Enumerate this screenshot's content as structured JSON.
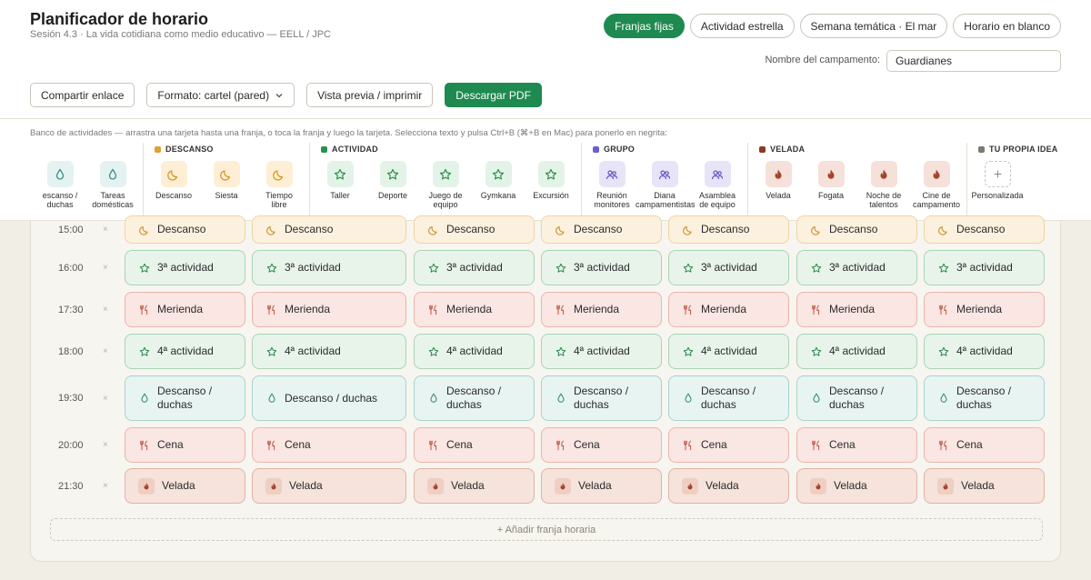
{
  "header": {
    "title": "Planificador de horario",
    "subtitle": "Sesión 4.3 · La vida cotidiana como medio educativo — EELL / JPC"
  },
  "modes": [
    {
      "label": "Franjas fijas",
      "active": true
    },
    {
      "label": "Actividad estrella",
      "active": false
    },
    {
      "label": "Semana temática · El mar",
      "active": false
    },
    {
      "label": "Horario en blanco",
      "active": false
    }
  ],
  "camp": {
    "label": "Nombre del campamento:",
    "value": "Guardianes"
  },
  "toolbar": {
    "share": "Compartir enlace",
    "format": "Formato: cartel (pared)",
    "preview": "Vista previa / imprimir",
    "download": "Descargar PDF"
  },
  "bank": {
    "hint": "Banco de actividades — arrastra una tarjeta hasta una franja, o toca la franja y luego la tarjeta. Selecciona texto y pulsa Ctrl+B (⌘+B en Mac) para ponerlo en negrita:",
    "groups": [
      {
        "title": "",
        "color": "#3c8b86",
        "cards": [
          {
            "label": "escanso /\nduchas",
            "icon": "drop-icon",
            "kind": "shower"
          },
          {
            "label": "Tareas\ndomésticas",
            "icon": "drop-icon",
            "kind": "shower"
          }
        ]
      },
      {
        "title": "DESCANSO",
        "color": "#e0a22a",
        "cards": [
          {
            "label": "Descanso",
            "icon": "moon-icon",
            "kind": "rest"
          },
          {
            "label": "Siesta",
            "icon": "moon-icon",
            "kind": "rest"
          },
          {
            "label": "Tiempo\nlibre",
            "icon": "moon-icon",
            "kind": "rest"
          }
        ]
      },
      {
        "title": "ACTIVIDAD",
        "color": "#2a9150",
        "cards": [
          {
            "label": "Taller",
            "icon": "star-icon",
            "kind": "act"
          },
          {
            "label": "Deporte",
            "icon": "star-icon",
            "kind": "act"
          },
          {
            "label": "Juego de\nequipo",
            "icon": "star-icon",
            "kind": "act"
          },
          {
            "label": "Gymkana",
            "icon": "star-icon",
            "kind": "act"
          },
          {
            "label": "Excursión",
            "icon": "star-icon",
            "kind": "act"
          }
        ]
      },
      {
        "title": "GRUPO",
        "color": "#6a5fd0",
        "cards": [
          {
            "label": "Reunión\nmonitores",
            "icon": "people-icon",
            "kind": "grp"
          },
          {
            "label": "Diana\ncampamentistas",
            "icon": "people-icon",
            "kind": "grp"
          },
          {
            "label": "Asamblea\nde equipo",
            "icon": "people-icon",
            "kind": "grp"
          }
        ]
      },
      {
        "title": "VELADA",
        "color": "#8c3a24",
        "cards": [
          {
            "label": "Velada",
            "icon": "flame-icon",
            "kind": "vel"
          },
          {
            "label": "Fogata",
            "icon": "flame-icon",
            "kind": "vel"
          },
          {
            "label": "Noche de\ntalentos",
            "icon": "flame-icon",
            "kind": "vel"
          },
          {
            "label": "Cine de\ncampamento",
            "icon": "flame-icon",
            "kind": "vel"
          }
        ]
      },
      {
        "title": "TU PROPIA IDEA",
        "color": "#7a7a6e",
        "cards": [
          {
            "label": "Personalizada",
            "icon": "plus-icon",
            "kind": "own"
          }
        ]
      }
    ]
  },
  "schedule": {
    "remove_symbol": "×",
    "rows": [
      {
        "time": "15:00",
        "kind": "rest",
        "icon": "moon-icon",
        "labels": [
          "Descanso",
          "Descanso",
          "Descanso",
          "Descanso",
          "Descanso",
          "Descanso",
          "Descanso"
        ]
      },
      {
        "time": "16:00",
        "kind": "act",
        "icon": "star-icon",
        "labels": [
          "3ª actividad",
          "3ª actividad",
          "3ª actividad",
          "3ª actividad",
          "3ª actividad",
          "3ª actividad",
          "3ª actividad"
        ]
      },
      {
        "time": "17:30",
        "kind": "meal",
        "icon": "fork-knife-icon",
        "labels": [
          "Merienda",
          "Merienda",
          "Merienda",
          "Merienda",
          "Merienda",
          "Merienda",
          "Merienda"
        ]
      },
      {
        "time": "18:00",
        "kind": "act",
        "icon": "star-icon",
        "labels": [
          "4ª actividad",
          "4ª actividad",
          "4ª actividad",
          "4ª actividad",
          "4ª actividad",
          "4ª actividad",
          "4ª actividad"
        ]
      },
      {
        "time": "19:30",
        "kind": "shower",
        "icon": "drop-icon",
        "labels": [
          "Descanso /\nduchas",
          "Descanso / duchas",
          "Descanso /\nduchas",
          "Descanso /\nduchas",
          "Descanso /\nduchas",
          "Descanso /\nduchas",
          "Descanso /\nduchas"
        ]
      },
      {
        "time": "20:00",
        "kind": "meal",
        "icon": "fork-knife-icon",
        "labels": [
          "Cena",
          "Cena",
          "Cena",
          "Cena",
          "Cena",
          "Cena",
          "Cena"
        ]
      },
      {
        "time": "21:30",
        "kind": "vel",
        "icon": "flame-icon",
        "labels": [
          "Velada",
          "Velada",
          "Velada",
          "Velada",
          "Velada",
          "Velada",
          "Velada"
        ]
      }
    ],
    "add_row": "+ Añadir franja horaria"
  }
}
